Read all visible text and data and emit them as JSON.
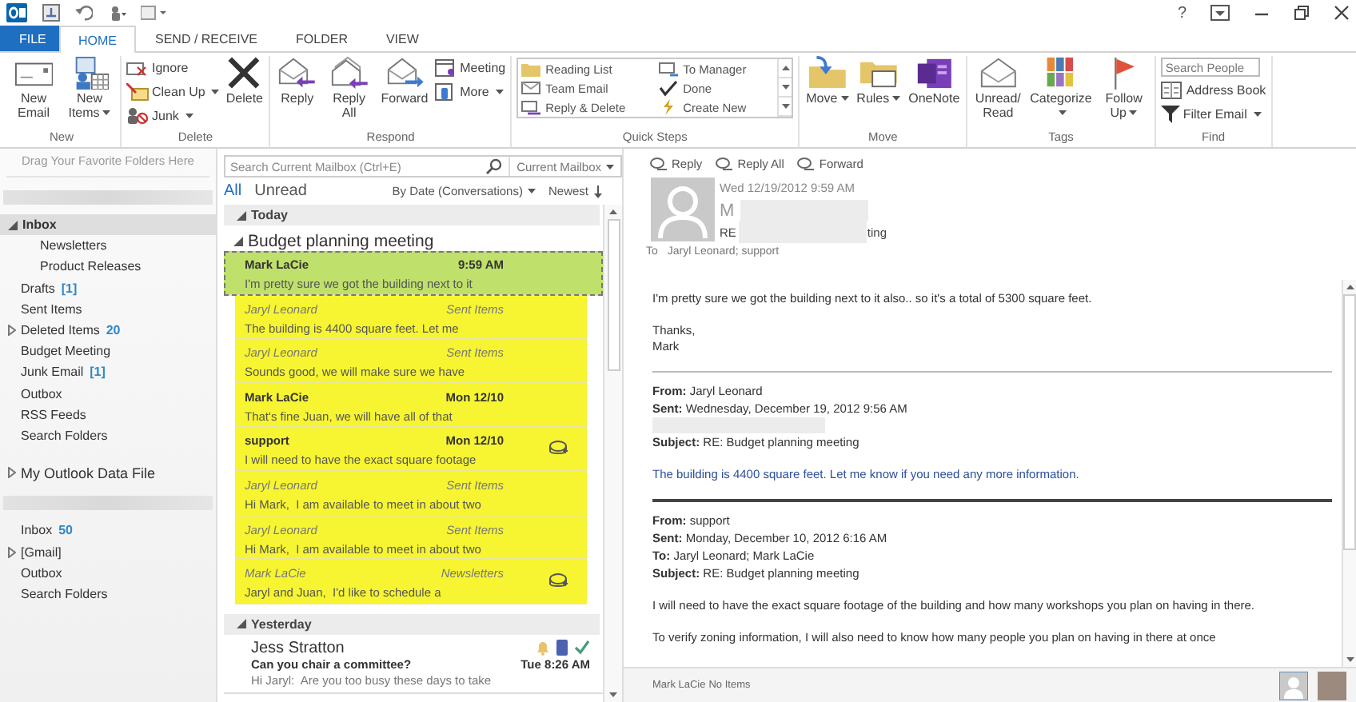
{
  "title_bar": {
    "help": "?"
  },
  "tabs": [
    {
      "label": "FILE",
      "kind": "file",
      "selected": false
    },
    {
      "label": "HOME",
      "kind": "tab",
      "selected": true
    },
    {
      "label": "SEND / RECEIVE",
      "kind": "tab",
      "selected": false
    },
    {
      "label": "FOLDER",
      "kind": "tab",
      "selected": false
    },
    {
      "label": "VIEW",
      "kind": "tab",
      "selected": false
    }
  ],
  "ribbon": [
    {
      "label": "New",
      "items": [
        {
          "kind": "large",
          "label": "New Email"
        },
        {
          "kind": "large",
          "label": "New Items",
          "dropdown": true
        }
      ]
    },
    {
      "label": "Delete",
      "items": [
        {
          "kind": "stack",
          "items": [
            {
              "kind": "button",
              "label": "Ignore"
            },
            {
              "kind": "button",
              "label": "Clean Up",
              "dropdown": true
            },
            {
              "kind": "button",
              "label": "Junk",
              "dropdown": true
            }
          ]
        },
        {
          "kind": "large",
          "label": "Delete"
        }
      ]
    },
    {
      "label": "Respond",
      "items": [
        {
          "kind": "large",
          "label": "Reply"
        },
        {
          "kind": "large",
          "label": "Reply All"
        },
        {
          "kind": "large",
          "label": "Forward"
        },
        {
          "kind": "stack",
          "items": [
            {
              "kind": "button",
              "label": "Meeting"
            },
            {
              "kind": "button",
              "label": "More",
              "dropdown": true
            }
          ]
        }
      ]
    },
    {
      "label": "Quick Steps",
      "items": [
        {
          "kind": "gallery",
          "items": [
            {
              "label": "Reading List"
            },
            {
              "label": "To Manager"
            },
            {
              "label": "Team Email"
            },
            {
              "label": "Done"
            },
            {
              "label": "Reply & Delete"
            },
            {
              "label": "Create New"
            }
          ]
        }
      ]
    },
    {
      "label": "Move",
      "items": [
        {
          "kind": "large",
          "label": "Move",
          "dropdown": true
        },
        {
          "kind": "large",
          "label": "Rules",
          "dropdown": true
        },
        {
          "kind": "large",
          "label": "OneNote"
        }
      ]
    },
    {
      "label": "Tags",
      "items": [
        {
          "kind": "large",
          "label": "Unread/ Read"
        },
        {
          "kind": "large",
          "label": "Categorize",
          "dropdown": true
        },
        {
          "kind": "large",
          "label": "Follow Up",
          "dropdown": true
        }
      ]
    },
    {
      "label": "Find",
      "items": [
        {
          "kind": "stack",
          "items": [
            {
              "kind": "search",
              "placeholder": "Search People"
            },
            {
              "kind": "button",
              "label": "Address Book"
            },
            {
              "kind": "button",
              "label": "Filter Email",
              "dropdown": true
            }
          ]
        }
      ]
    }
  ],
  "folder_pane": {
    "hint": "Drag Your Favorite Folders Here",
    "sections": [
      {
        "kind": "account",
        "folders": [
          {
            "label": "Inbox",
            "expanded": true,
            "selected": true,
            "children": [
              {
                "label": "Newsletters",
                "selected": false
              },
              {
                "label": "Product Releases",
                "selected": false
              }
            ]
          },
          {
            "label": "Drafts",
            "count": "[1]",
            "selected": false
          },
          {
            "label": "Sent Items",
            "selected": false
          },
          {
            "label": "Deleted Items",
            "count": "20",
            "expanded": false,
            "selected": false
          },
          {
            "label": "Budget Meeting",
            "selected": false
          },
          {
            "label": "Junk Email",
            "count": "[1]",
            "selected": false
          },
          {
            "label": "Outbox",
            "selected": false
          },
          {
            "label": "RSS Feeds",
            "selected": false
          },
          {
            "label": "Search Folders",
            "selected": false
          }
        ]
      },
      {
        "kind": "datafile",
        "label": "My Outlook Data File",
        "expanded": false
      },
      {
        "kind": "account",
        "folders": [
          {
            "label": "Inbox",
            "count": "50",
            "selected": false
          },
          {
            "label": "[Gmail]",
            "expanded": false,
            "selected": false
          },
          {
            "label": "Outbox",
            "selected": false
          },
          {
            "label": "Search Folders",
            "selected": false
          }
        ]
      }
    ]
  },
  "message_list": {
    "search": {
      "placeholder": "Search Current Mailbox (Ctrl+E)",
      "scope": "Current Mailbox"
    },
    "filters": [
      {
        "label": "All",
        "selected": true
      },
      {
        "label": "Unread",
        "selected": false
      }
    ],
    "sort": "By Date (Conversations)",
    "order": "Newest",
    "groups": [
      {
        "label": "Today",
        "conversations": [
          {
            "kind": "thread",
            "subject": "Budget planning meeting",
            "highlighted": true,
            "messages": [
              {
                "sender": "Mark LaCie",
                "info": "9:59 AM",
                "preview": "I'm pretty sure we got the building next to it",
                "kind": "received",
                "selected": true,
                "meeting": false
              },
              {
                "sender": "Jaryl Leonard",
                "info": "Sent Items",
                "preview": "The building is 4400 square feet. Let me",
                "kind": "sent",
                "selected": false,
                "meeting": false
              },
              {
                "sender": "Jaryl Leonard",
                "info": "Sent Items",
                "preview": "Sounds good, we will make sure we have",
                "kind": "sent",
                "selected": false,
                "meeting": false
              },
              {
                "sender": "Mark LaCie",
                "info": "Mon 12/10",
                "preview": "That's fine Juan, we will have all of that",
                "kind": "received",
                "selected": false,
                "meeting": false
              },
              {
                "sender": "support",
                "info": "Mon 12/10",
                "preview": "I will need to have the exact square footage",
                "kind": "received",
                "selected": false,
                "meeting": true
              },
              {
                "sender": "Jaryl Leonard",
                "info": "Sent Items",
                "preview": "Hi Mark,  I am available to meet in about two",
                "kind": "sent",
                "selected": false,
                "meeting": false
              },
              {
                "sender": "Jaryl Leonard",
                "info": "Sent Items",
                "preview": "Hi Mark,  I am available to meet in about two",
                "kind": "sent",
                "selected": false,
                "meeting": false
              },
              {
                "sender": "Mark LaCie",
                "info": "Newsletters",
                "preview": "Jaryl and Juan,  I'd like to schedule a",
                "kind": "sent",
                "selected": false,
                "meeting": true
              }
            ]
          }
        ]
      },
      {
        "label": "Yesterday",
        "conversations": [
          {
            "kind": "single",
            "sender": "Jess Stratton",
            "subject": "Can you chair a committee?",
            "info": "Tue 8:26 AM",
            "preview": "Hi Jaryl:  Are you too busy these days to take",
            "selected": false
          }
        ]
      }
    ]
  },
  "reading_pane": {
    "actions": [
      "Reply",
      "Reply All",
      "Forward"
    ],
    "date": "Wed 12/19/2012 9:59 AM",
    "sender": "M",
    "subject_start": "RE",
    "subject_end": "ting",
    "to_label": "To",
    "recipients": "Jaryl Leonard; support",
    "body": [
      {
        "kind": "text",
        "lines": [
          "I'm pretty sure we got the building next to it also.. so it's a total of 5300 square feet."
        ]
      },
      {
        "kind": "text",
        "lines": [
          "Thanks,",
          "Mark"
        ]
      },
      {
        "kind": "thin_rule"
      },
      {
        "kind": "header",
        "lines": [
          "**From:** Jaryl Leonard",
          "**Sent:** Wednesday, December 19, 2012 9:56 AM"
        ]
      },
      {
        "kind": "redacted"
      },
      {
        "kind": "header",
        "lines": [
          "**Subject:** RE: Budget planning meeting"
        ]
      },
      {
        "kind": "quote",
        "lines": [
          "The building is 4400 square feet. Let me know if you need any more information."
        ]
      },
      {
        "kind": "thick_rule"
      },
      {
        "kind": "header",
        "lines": [
          "**From:** support",
          "**Sent:** Monday, December 10, 2012 6:16 AM",
          "**To:** Jaryl Leonard; Mark LaCie",
          "**Subject:** RE: Budget planning meeting"
        ]
      },
      {
        "kind": "text",
        "lines": [
          "I will need to have the exact square footage of the building and how many workshops you plan on having in there."
        ]
      },
      {
        "kind": "text",
        "lines": [
          "To verify zoning information, I will also need to know how many people you plan on having in there at once"
        ]
      }
    ]
  },
  "people_pane": {
    "name": "Mark LaCie",
    "status": "No Items"
  }
}
